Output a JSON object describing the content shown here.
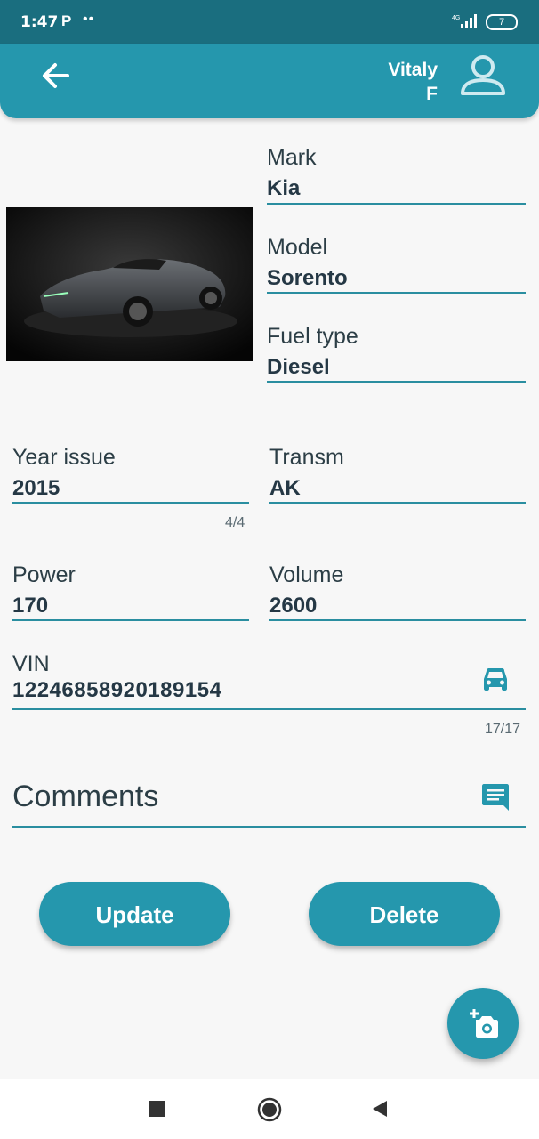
{
  "status_bar": {
    "time": "1:47",
    "app_indicator": "P",
    "dots": "••",
    "network": "4G",
    "battery": "7"
  },
  "app_bar": {
    "user_first": "Vitaly",
    "user_last": "F"
  },
  "fields": {
    "mark": {
      "label": "Mark",
      "value": "Kia"
    },
    "model": {
      "label": "Model",
      "value": "Sorento"
    },
    "fuel_type": {
      "label": "Fuel type",
      "value": "Diesel"
    },
    "year_issue": {
      "label": "Year issue",
      "value": "2015",
      "counter": "4/4"
    },
    "transm": {
      "label": "Transm",
      "value": "AK"
    },
    "power": {
      "label": "Power",
      "value": "170"
    },
    "volume": {
      "label": "Volume",
      "value": "2600"
    },
    "vin": {
      "label": "VIN",
      "value": "12246858920189154",
      "counter": "17/17"
    }
  },
  "comments": {
    "placeholder": "Comments"
  },
  "buttons": {
    "update": "Update",
    "delete": "Delete"
  },
  "colors": {
    "primary": "#2597ad",
    "status_bar": "#1a6e7f",
    "underline": "#2a8ea0",
    "background": "#f7f7f7"
  },
  "icons": [
    "back-arrow-icon",
    "user-icon",
    "car-icon",
    "comment-icon",
    "add-photo-icon",
    "nav-recents-icon",
    "nav-home-icon",
    "nav-back-icon"
  ]
}
